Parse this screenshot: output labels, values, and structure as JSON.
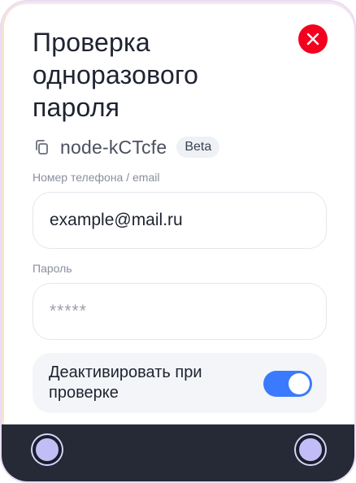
{
  "dialog": {
    "title": "Проверка одноразового пароля",
    "node_id": "node-kCTcfe",
    "badge": "Beta"
  },
  "fields": {
    "login": {
      "label": "Номер телефона / email",
      "value": "example@mail.ru"
    },
    "password": {
      "label": "Пароль",
      "placeholder": "*****"
    }
  },
  "toggle": {
    "label": "Деактивировать при проверке",
    "enabled": true
  },
  "icons": {
    "close": "close-icon",
    "copy": "copy-icon"
  },
  "colors": {
    "close_button": "#f2001e",
    "switch_on": "#3a7afe",
    "footer": "#252a36",
    "footer_dot": "#c3bdf7"
  }
}
